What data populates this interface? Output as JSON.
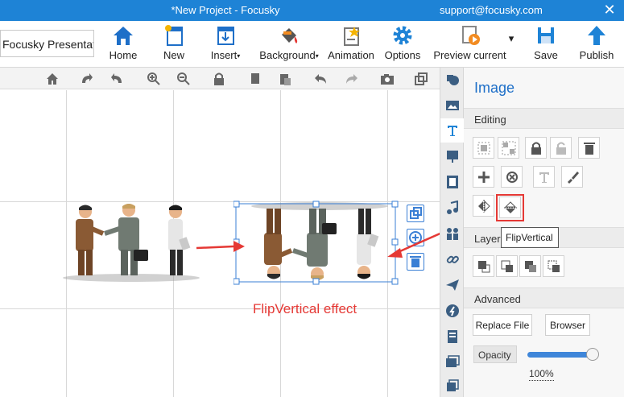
{
  "window": {
    "title": "*New Project - Focusky",
    "support": "support@focusky.com",
    "close": "✕"
  },
  "toolbar": {
    "project_name": "Focusky Presentation",
    "home": "Home",
    "new": "New",
    "insert": "Insert",
    "background": "Background",
    "animation": "Animation",
    "options": "Options",
    "preview": "Preview current",
    "save": "Save",
    "publish": "Publish",
    "caret": "▾"
  },
  "canvas": {
    "effect_label": "FlipVertical effect"
  },
  "panel": {
    "title": "Image",
    "editing": "Editing",
    "layering": "Layering",
    "advanced": "Advanced",
    "tooltip": "FlipVertical",
    "replace_file": "Replace File",
    "browser": "Browser",
    "opacity_label": "Opacity",
    "opacity_value": "100%",
    "opacity_fraction": 1.0
  },
  "colors": {
    "accent": "#1e83d6",
    "highlight": "#e53935",
    "selection": "#3a7fd5"
  }
}
